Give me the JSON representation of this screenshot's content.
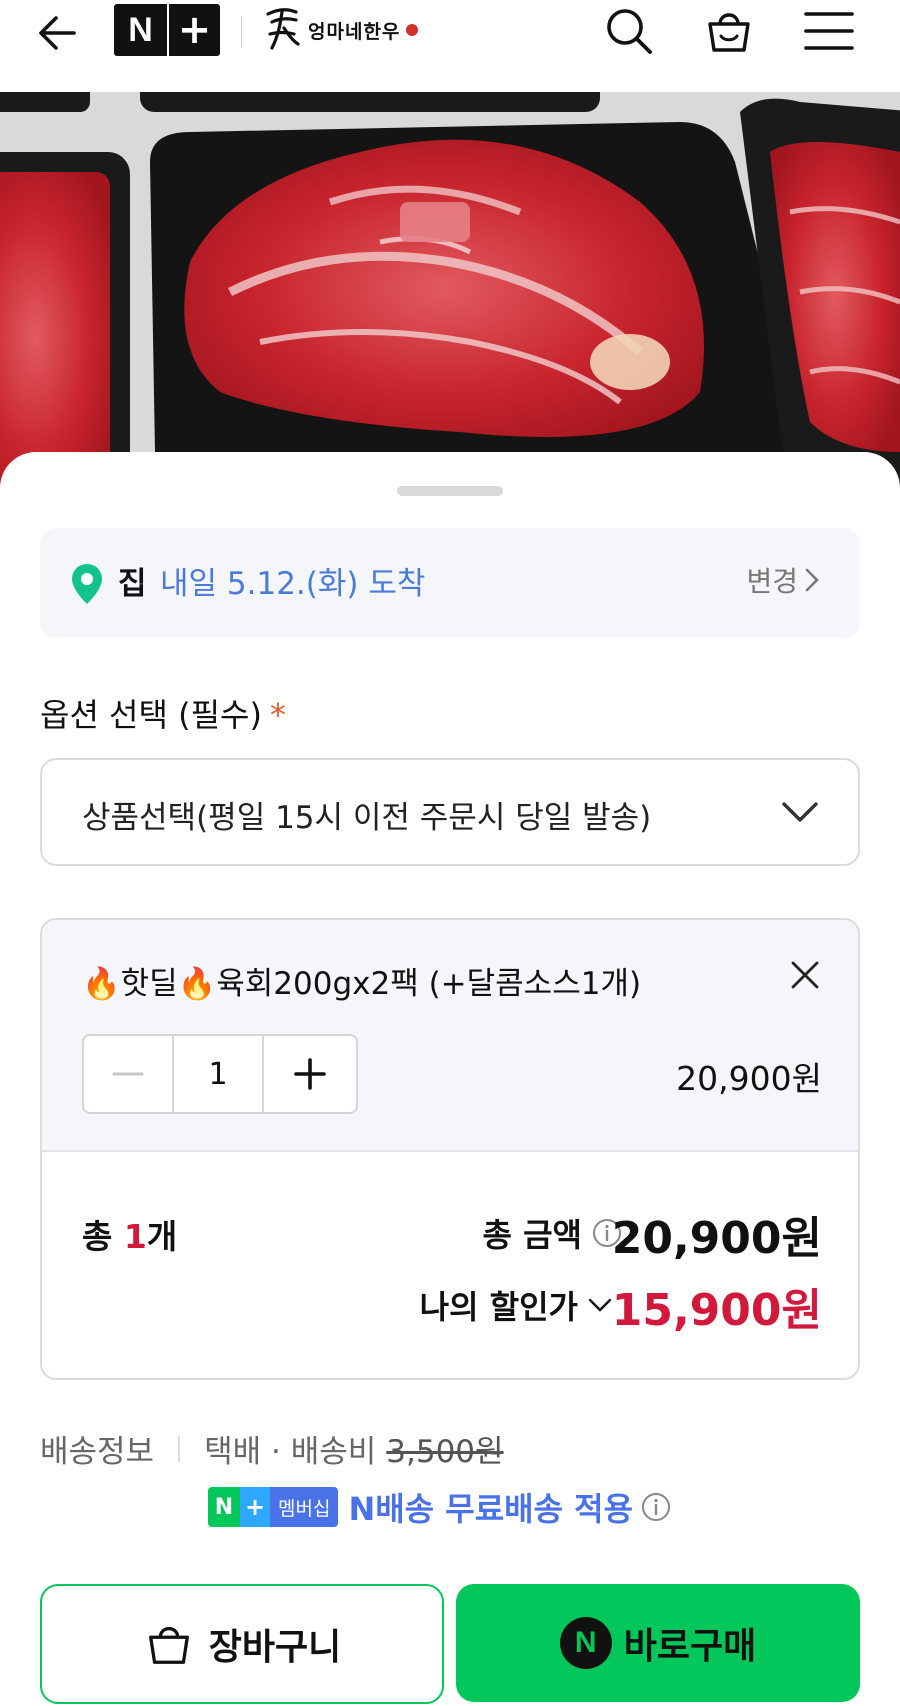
{
  "header": {
    "back_icon": "back-arrow-icon",
    "nplus_n": "N",
    "nplus_plus": "+",
    "brand_name": "엉마네한우",
    "icons": [
      "search-icon",
      "shopping-bag-icon",
      "menu-icon"
    ]
  },
  "hero": {
    "image": "marbled-beef-in-black-trays"
  },
  "delivery": {
    "place": "집",
    "date": "내일 5.12.(화) 도착",
    "change": "변경"
  },
  "option": {
    "label": "옵션 선택 (필수)",
    "required_mark": "*",
    "select_value": "상품선택(평일 15시 이전 주문시 당일 발송)"
  },
  "item": {
    "name": "🔥핫딜🔥육회200gx2팩 (+달콤소스1개)",
    "quantity": "1",
    "price": "20,900원"
  },
  "totals": {
    "count_prefix": "총 ",
    "count_num": "1",
    "count_suffix": "개",
    "total_label": "총 금액",
    "total_price": "20,900원",
    "discount_label": "나의 할인가",
    "discount_price": "15,900원"
  },
  "shipping": {
    "label": "배송정보",
    "method": "택배 · 배송비",
    "original_fee": "3,500원",
    "badge_n": "N",
    "badge_plus": "+",
    "badge_member": "멤버십",
    "member_text": "N배송 무료배송 적용"
  },
  "buttons": {
    "cart": "장바구니",
    "buy_logo": "N",
    "buy": "바로구매"
  },
  "colors": {
    "accent_green": "#03c75a",
    "price_red": "#d1193b",
    "link_blue": "#4a7bd8",
    "member_blue": "#4a72e8"
  }
}
